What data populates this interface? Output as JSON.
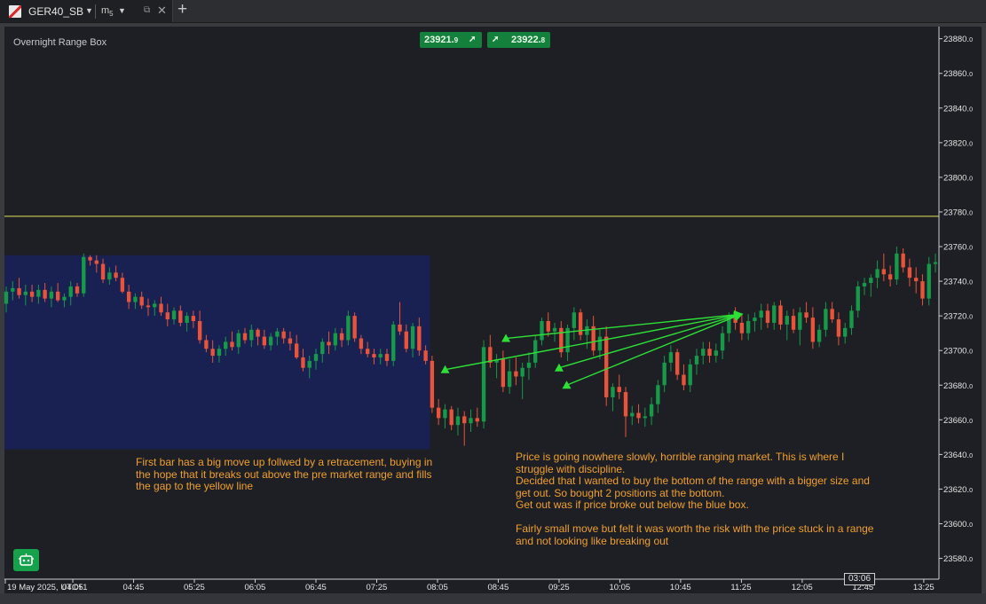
{
  "tab": {
    "symbol": "GER40_SB",
    "timeframe_main": "m",
    "timeframe_sub": "5",
    "dropdown_glyph": "▼",
    "popout_glyph": "⧉",
    "close_glyph": "✕",
    "add_glyph": "+"
  },
  "chart": {
    "indicator_label": "Overnight Range Box",
    "bid_price": "23921.",
    "bid_decimal": "9",
    "ask_price": "23922.",
    "ask_decimal": "8",
    "bid_arrow": "➚",
    "ask_arrow": "➚",
    "current_time": "03:06",
    "annotation_left": [
      "First bar has a big move up follwed by a retracement, buying in",
      "the hope that it breaks out above the pre market range and fills",
      "the gap to the yellow line"
    ],
    "annotation_right": [
      "Price is going nowhere slowly, horrible ranging market. This is where I",
      "struggle with discipline.",
      "Decided that I wanted to buy the bottom of the range with a bigger size and",
      "get out. So bought 2 positions at the bottom.",
      "Get out was if price broke out below the blue box.",
      "",
      "Fairly small move but felt it was worth the risk with the price stuck in a range",
      "and not looking like breaking out"
    ],
    "colors": {
      "background": "#1e1f25",
      "bull": "#169949",
      "bear": "#e8533a",
      "range_box": "#182152",
      "yellow_line": "#e6e45a",
      "arrows": "#2de036",
      "annotation": "#f0a02a"
    }
  },
  "chart_data": {
    "type": "candlestick",
    "title": "",
    "price_axis_labels": [
      "23880.0",
      "23860.0",
      "23840.0",
      "23820.0",
      "23800.0",
      "23780.0",
      "23760.0",
      "23740.0",
      "23720.0",
      "23700.0",
      "23680.0",
      "23660.0",
      "23640.0",
      "23620.0",
      "23600.0",
      "23580.0"
    ],
    "ylim": [
      23568,
      23887
    ],
    "time_axis_labels": [
      "19 May 2025, UTC+1",
      "04:05",
      "04:45",
      "05:25",
      "06:05",
      "06:45",
      "07:25",
      "08:05",
      "08:45",
      "09:25",
      "10:05",
      "10:45",
      "11:25",
      "12:05",
      "12:45",
      "13:25"
    ],
    "yellow_line_price": 23777.5,
    "overnight_range_box": {
      "high": 23755,
      "low": 23643,
      "start": "03:20",
      "end": "08:00"
    },
    "candles_ohlc": [
      [
        23727,
        23737,
        23722,
        23734
      ],
      [
        23734,
        23740,
        23729,
        23736
      ],
      [
        23736,
        23742,
        23730,
        23732
      ],
      [
        23732,
        23738,
        23726,
        23734
      ],
      [
        23734,
        23738,
        23728,
        23731
      ],
      [
        23731,
        23738,
        23727,
        23735
      ],
      [
        23735,
        23739,
        23728,
        23730
      ],
      [
        23730,
        23737,
        23725,
        23734
      ],
      [
        23734,
        23739,
        23728,
        23729
      ],
      [
        23729,
        23733,
        23725,
        23731
      ],
      [
        23731,
        23740,
        23726,
        23737
      ],
      [
        23737,
        23739,
        23731,
        23733
      ],
      [
        23733,
        23756,
        23731,
        23754
      ],
      [
        23754,
        23755,
        23749,
        23752
      ],
      [
        23752,
        23755,
        23745,
        23750
      ],
      [
        23750,
        23753,
        23739,
        23741
      ],
      [
        23741,
        23748,
        23738,
        23745
      ],
      [
        23745,
        23749,
        23740,
        23742
      ],
      [
        23742,
        23745,
        23733,
        23734
      ],
      [
        23734,
        23738,
        23724,
        23728
      ],
      [
        23728,
        23733,
        23724,
        23731
      ],
      [
        23731,
        23734,
        23724,
        23726
      ],
      [
        23726,
        23730,
        23720,
        23725
      ],
      [
        23725,
        23729,
        23720,
        23727
      ],
      [
        23727,
        23731,
        23720,
        23722
      ],
      [
        23722,
        23727,
        23714,
        23718
      ],
      [
        23718,
        23725,
        23715,
        23723
      ],
      [
        23723,
        23726,
        23714,
        23716
      ],
      [
        23716,
        23722,
        23711,
        23720
      ],
      [
        23720,
        23723,
        23713,
        23717
      ],
      [
        23717,
        23723,
        23704,
        23706
      ],
      [
        23706,
        23709,
        23699,
        23701
      ],
      [
        23701,
        23706,
        23693,
        23697
      ],
      [
        23697,
        23703,
        23693,
        23701
      ],
      [
        23701,
        23708,
        23697,
        23705
      ],
      [
        23705,
        23711,
        23700,
        23702
      ],
      [
        23702,
        23712,
        23698,
        23710
      ],
      [
        23710,
        23713,
        23704,
        23706
      ],
      [
        23706,
        23715,
        23702,
        23712
      ],
      [
        23712,
        23713,
        23703,
        23708
      ],
      [
        23708,
        23712,
        23701,
        23703
      ],
      [
        23703,
        23710,
        23700,
        23708
      ],
      [
        23708,
        23713,
        23703,
        23711
      ],
      [
        23711,
        23713,
        23704,
        23707
      ],
      [
        23707,
        23711,
        23700,
        23704
      ],
      [
        23704,
        23709,
        23695,
        23696
      ],
      [
        23696,
        23701,
        23688,
        23690
      ],
      [
        23690,
        23697,
        23684,
        23694
      ],
      [
        23694,
        23701,
        23689,
        23698
      ],
      [
        23698,
        23707,
        23693,
        23705
      ],
      [
        23705,
        23711,
        23698,
        23703
      ],
      [
        23703,
        23713,
        23700,
        23710
      ],
      [
        23710,
        23713,
        23702,
        23706
      ],
      [
        23706,
        23723,
        23703,
        23720
      ],
      [
        23720,
        23722,
        23705,
        23707
      ],
      [
        23707,
        23709,
        23698,
        23701
      ],
      [
        23701,
        23705,
        23696,
        23698
      ],
      [
        23698,
        23701,
        23692,
        23696
      ],
      [
        23696,
        23701,
        23692,
        23698
      ],
      [
        23698,
        23701,
        23691,
        23694
      ],
      [
        23694,
        23717,
        23691,
        23715
      ],
      [
        23715,
        23728,
        23709,
        23711
      ],
      [
        23711,
        23715,
        23699,
        23701
      ],
      [
        23701,
        23716,
        23696,
        23714
      ],
      [
        23714,
        23719,
        23697,
        23700
      ],
      [
        23700,
        23703,
        23692,
        23694
      ],
      [
        23694,
        23697,
        23664,
        23667
      ],
      [
        23667,
        23672,
        23657,
        23661
      ],
      [
        23661,
        23669,
        23655,
        23666
      ],
      [
        23666,
        23668,
        23654,
        23657
      ],
      [
        23657,
        23667,
        23651,
        23662
      ],
      [
        23662,
        23665,
        23645,
        23658
      ],
      [
        23658,
        23666,
        23653,
        23661
      ],
      [
        23661,
        23667,
        23656,
        23659
      ],
      [
        23659,
        23706,
        23655,
        23702
      ],
      [
        23702,
        23709,
        23690,
        23693
      ],
      [
        23693,
        23698,
        23684,
        23695
      ],
      [
        23695,
        23700,
        23676,
        23679
      ],
      [
        23679,
        23695,
        23675,
        23688
      ],
      [
        23688,
        23696,
        23680,
        23685
      ],
      [
        23685,
        23693,
        23672,
        23690
      ],
      [
        23690,
        23699,
        23683,
        23693
      ],
      [
        23693,
        23709,
        23690,
        23706
      ],
      [
        23706,
        23719,
        23703,
        23717
      ],
      [
        23717,
        23722,
        23708,
        23711
      ],
      [
        23711,
        23716,
        23705,
        23713
      ],
      [
        23713,
        23717,
        23696,
        23699
      ],
      [
        23699,
        23715,
        23694,
        23713
      ],
      [
        23713,
        23725,
        23706,
        23722
      ],
      [
        23722,
        23724,
        23706,
        23709
      ],
      [
        23709,
        23718,
        23701,
        23714
      ],
      [
        23714,
        23720,
        23697,
        23700
      ],
      [
        23700,
        23712,
        23695,
        23708
      ],
      [
        23708,
        23714,
        23668,
        23673
      ],
      [
        23673,
        23681,
        23665,
        23679
      ],
      [
        23679,
        23686,
        23672,
        23676
      ],
      [
        23676,
        23679,
        23650,
        23662
      ],
      [
        23662,
        23668,
        23657,
        23664
      ],
      [
        23664,
        23669,
        23658,
        23661
      ],
      [
        23661,
        23667,
        23656,
        23662
      ],
      [
        23662,
        23673,
        23657,
        23669
      ],
      [
        23669,
        23683,
        23664,
        23680
      ],
      [
        23680,
        23697,
        23676,
        23693
      ],
      [
        23693,
        23703,
        23688,
        23699
      ],
      [
        23699,
        23701,
        23683,
        23686
      ],
      [
        23686,
        23692,
        23677,
        23680
      ],
      [
        23680,
        23695,
        23676,
        23692
      ],
      [
        23692,
        23701,
        23686,
        23697
      ],
      [
        23697,
        23705,
        23692,
        23701
      ],
      [
        23701,
        23705,
        23693,
        23697
      ],
      [
        23697,
        23704,
        23693,
        23700
      ],
      [
        23700,
        23714,
        23695,
        23710
      ],
      [
        23710,
        23722,
        23705,
        23719
      ],
      [
        23719,
        23725,
        23712,
        23716
      ],
      [
        23716,
        23721,
        23706,
        23710
      ],
      [
        23710,
        23721,
        23706,
        23717
      ],
      [
        23717,
        23722,
        23711,
        23719
      ],
      [
        23719,
        23727,
        23712,
        23723
      ],
      [
        23723,
        23727,
        23713,
        23716
      ],
      [
        23716,
        23728,
        23712,
        23726
      ],
      [
        23726,
        23729,
        23712,
        23715
      ],
      [
        23715,
        23723,
        23706,
        23720
      ],
      [
        23720,
        23724,
        23710,
        23712
      ],
      [
        23712,
        23725,
        23703,
        23722
      ],
      [
        23722,
        23728,
        23716,
        23719
      ],
      [
        23719,
        23725,
        23701,
        23705
      ],
      [
        23705,
        23715,
        23702,
        23712
      ],
      [
        23712,
        23728,
        23708,
        23724
      ],
      [
        23724,
        23728,
        23716,
        23718
      ],
      [
        23718,
        23722,
        23703,
        23708
      ],
      [
        23708,
        23716,
        23704,
        23713
      ],
      [
        23713,
        23726,
        23709,
        23723
      ],
      [
        23723,
        23740,
        23719,
        23737
      ],
      [
        23737,
        23742,
        23732,
        23739
      ],
      [
        23739,
        23744,
        23731,
        23742
      ],
      [
        23742,
        23752,
        23736,
        23747
      ],
      [
        23747,
        23756,
        23740,
        23744
      ],
      [
        23744,
        23749,
        23737,
        23741
      ],
      [
        23741,
        23760,
        23738,
        23756
      ],
      [
        23756,
        23759,
        23745,
        23748
      ],
      [
        23748,
        23753,
        23737,
        23742
      ],
      [
        23742,
        23748,
        23733,
        23740
      ],
      [
        23740,
        23744,
        23726,
        23730
      ],
      [
        23730,
        23754,
        23726,
        23750
      ],
      [
        23750,
        23756,
        23745,
        23751
      ]
    ],
    "arrows": [
      {
        "from": [
          23689,
          "08:10"
        ],
        "to": [
          23721,
          "11:25"
        ]
      },
      {
        "from": [
          23707,
          "08:50"
        ],
        "to": [
          23721,
          "11:25"
        ]
      },
      {
        "from": [
          23690,
          "09:25"
        ],
        "to": [
          23721,
          "11:25"
        ]
      },
      {
        "from": [
          23680,
          "09:30"
        ],
        "to": [
          23721,
          "11:25"
        ]
      }
    ],
    "x_domain_minutes": [
      200,
      815
    ]
  }
}
